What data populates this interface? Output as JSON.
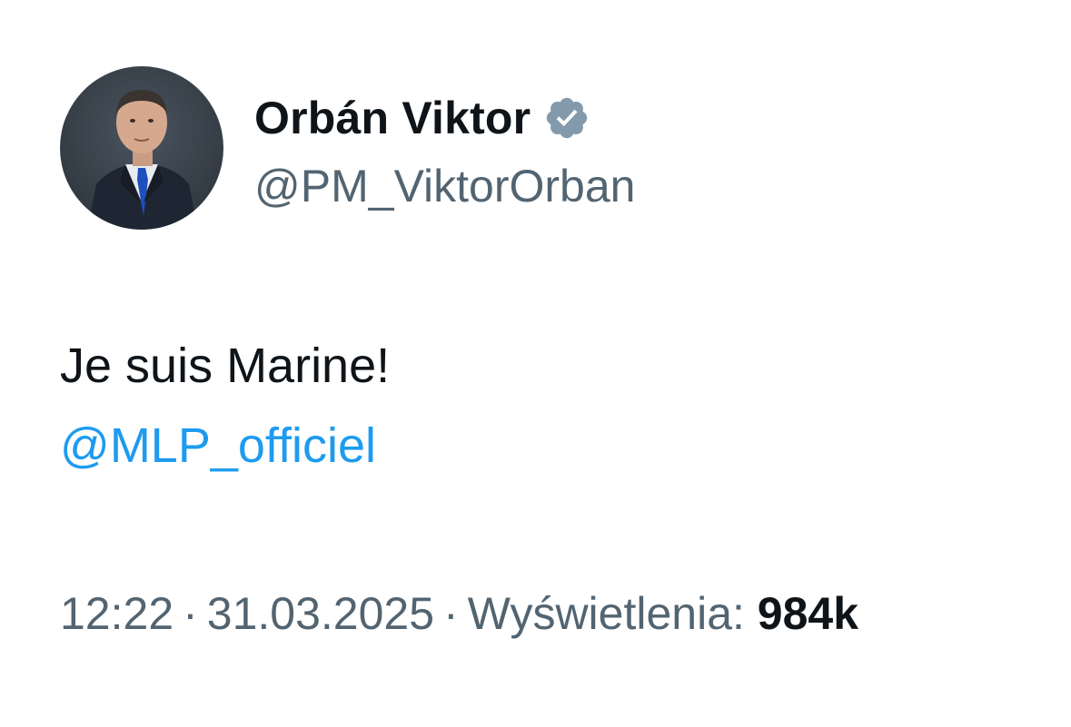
{
  "author": {
    "display_name": "Orbán Viktor",
    "handle": "@PM_ViktorOrban",
    "verified": true,
    "verified_badge_color": "#829aab",
    "avatar_icon": "profile-photo-man-in-suit"
  },
  "tweet": {
    "text": "Je suis Marine!",
    "mention": "@MLP_officiel",
    "mention_color": "#1d9bf0"
  },
  "meta": {
    "time": "12:22",
    "separator": "·",
    "date": "31.03.2025",
    "views_label": "Wyświetlenia:",
    "views_count": "984k"
  },
  "colors": {
    "text_primary": "#0f1419",
    "text_secondary": "#536471",
    "background": "#ffffff"
  }
}
